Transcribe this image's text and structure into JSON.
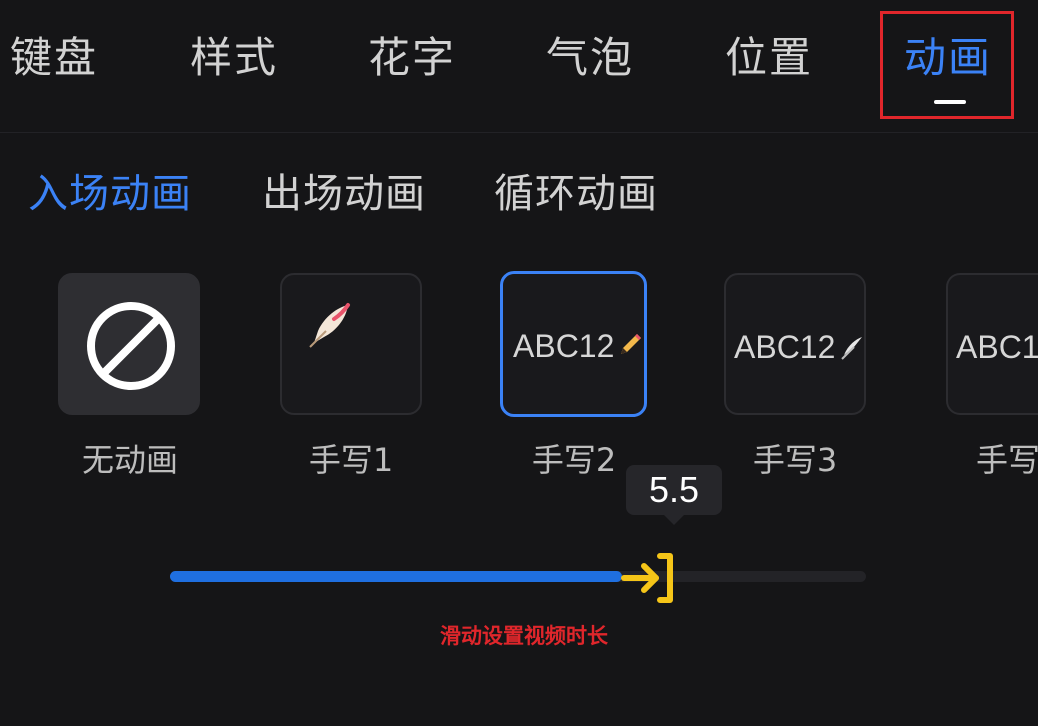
{
  "top_tabs": [
    "键盘",
    "样式",
    "花字",
    "气泡",
    "位置",
    "动画"
  ],
  "active_top_tab": "动画",
  "sub_tabs": [
    "入场动画",
    "出场动画",
    "循环动画"
  ],
  "active_sub_tab": "入场动画",
  "animations": [
    {
      "label": "无动画",
      "preview": "",
      "icon": "no-entry-icon"
    },
    {
      "label": "手写1",
      "preview": "",
      "icon": "feather-pen-icon"
    },
    {
      "label": "手写2",
      "preview": "ABC12",
      "icon": "pencil-icon"
    },
    {
      "label": "手写3",
      "preview": "ABC12",
      "icon": "quill-icon"
    },
    {
      "label": "手写",
      "preview": "ABC1",
      "icon": ""
    }
  ],
  "selected_animation": "手写2",
  "duration": {
    "value_text": "5.5",
    "fraction": 0.65,
    "fill_color": "#1f6fe0",
    "thumb_color": "#f5c518"
  },
  "hint_text": "滑动设置视频时长",
  "colors": {
    "accent": "#3b82f6",
    "annotation_red": "#e0262b"
  }
}
